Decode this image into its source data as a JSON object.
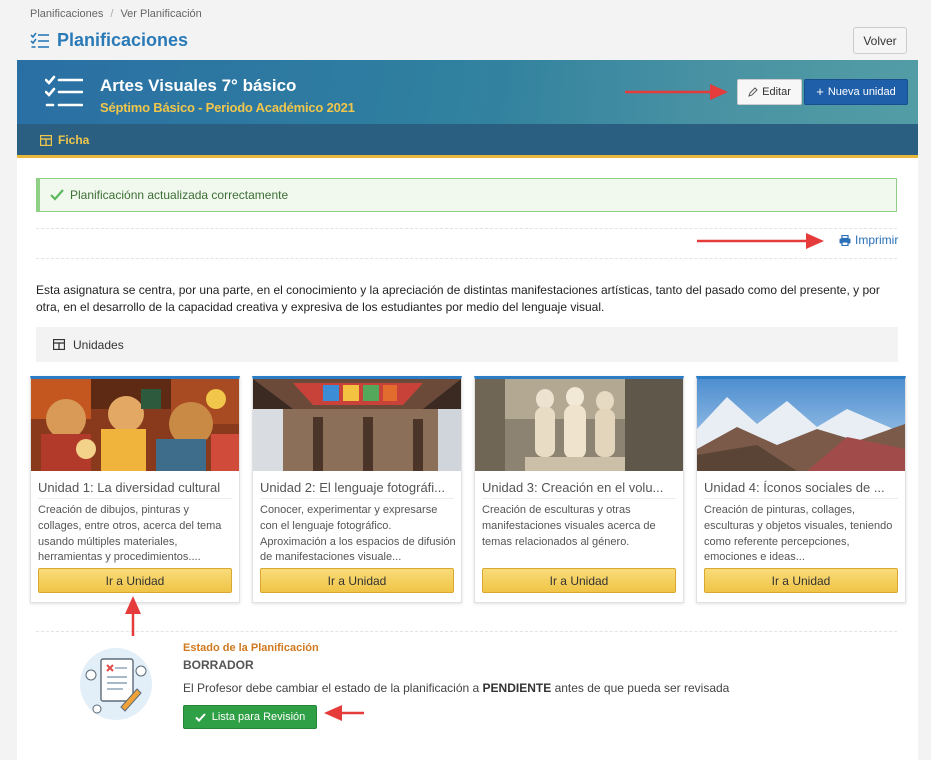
{
  "breadcrumb": {
    "items": [
      "Planificaciones",
      "Ver Planificación"
    ],
    "separator": "/"
  },
  "page": {
    "title": "Planificaciones",
    "back_label": "Volver"
  },
  "header": {
    "title": "Artes Visuales 7° básico",
    "subtitle": "Séptimo Básico - Periodo Académico 2021",
    "edit_label": "Editar",
    "new_unit_label": "Nueva unidad",
    "tab_label": "Ficha"
  },
  "alert": {
    "message": "Planificaciónn actualizada correctamente"
  },
  "print_label": "Imprimir",
  "description": "Esta asignatura se centra, por una parte, en el conocimiento y la apreciación de distintas manifestaciones artísticas, tanto del pasado como del presente, y por otra, en el desarrollo de la capacidad creativa y expresiva de los estudiantes por medio del lenguaje visual.",
  "units_header": "Unidades",
  "units": [
    {
      "title": "Unidad 1: La diversidad cultural",
      "description": "Creación de dibujos, pinturas y collages, entre otros, acerca del tema usando múltiples materiales, herramientas y procedimientos....",
      "button": "Ir a Unidad"
    },
    {
      "title": "Unidad 2: El lenguaje fotográfi...",
      "description": "Conocer, experimentar y expresarse con el lenguaje fotográfico. Aproximación a los espacios de difusión de manifestaciones visuale...",
      "button": "Ir a Unidad"
    },
    {
      "title": "Unidad 3: Creación en el volu...",
      "description": "Creación de esculturas y otras manifestaciones visuales acerca de temas relacionados al género.",
      "button": "Ir a Unidad"
    },
    {
      "title": "Unidad 4: Íconos sociales de ...",
      "description": "Creación de pinturas, collages, esculturas y objetos visuales, teniendo como referente percepciones, emociones e ideas...",
      "button": "Ir a Unidad"
    }
  ],
  "state": {
    "label": "Estado de la Planificación",
    "value": "BORRADOR",
    "message_before": "El Profesor debe cambiar el estado de la planificación a",
    "message_bold": "PENDIENTE",
    "message_after": "antes de que pueda ser revisada",
    "button": "Lista para Revisión"
  },
  "colors": {
    "accent_blue": "#2a6fb8",
    "gold": "#f0c64b",
    "success_green": "#2fa045",
    "annotation_red": "#e53b3b"
  },
  "icons": [
    "list-check-icon",
    "pencil-icon",
    "plus-icon",
    "table-icon",
    "check-icon",
    "printer-icon",
    "document-illustration-icon",
    "annotation-arrow-icon"
  ]
}
